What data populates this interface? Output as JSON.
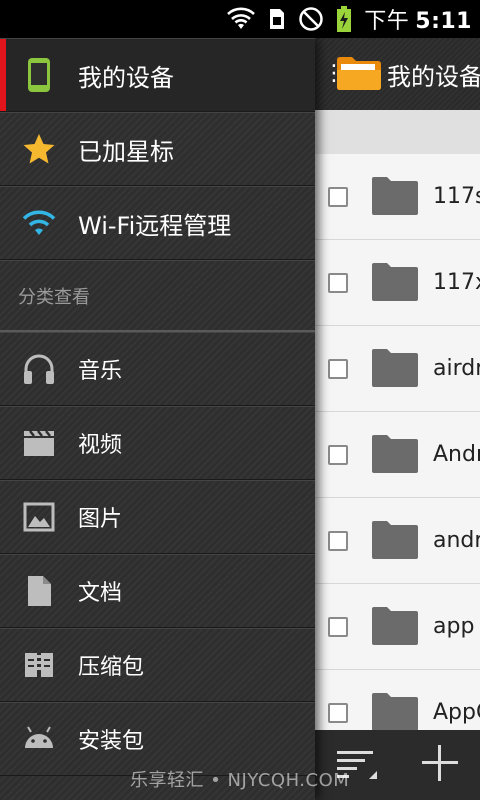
{
  "status_bar": {
    "ampm": "下午",
    "time": "5:11",
    "icons": [
      "wifi-icon",
      "sim-icon",
      "no-disturb-icon",
      "battery-charging-icon"
    ]
  },
  "drawer": {
    "top_items": [
      {
        "label": "我的设备",
        "icon": "device-icon",
        "active": true
      },
      {
        "label": "已加星标",
        "icon": "star-icon",
        "active": false
      },
      {
        "label": "Wi-Fi远程管理",
        "icon": "wifi-remote-icon",
        "active": false
      }
    ],
    "section_label": "分类查看",
    "categories": [
      {
        "label": "音乐",
        "icon": "headphones-icon"
      },
      {
        "label": "视频",
        "icon": "video-icon"
      },
      {
        "label": "图片",
        "icon": "image-icon"
      },
      {
        "label": "文档",
        "icon": "document-icon"
      },
      {
        "label": "压缩包",
        "icon": "archive-icon"
      },
      {
        "label": "安装包",
        "icon": "android-icon"
      }
    ]
  },
  "file_panel": {
    "title": "我的设备",
    "files": [
      {
        "name": "117s"
      },
      {
        "name": "117x"
      },
      {
        "name": "airdr"
      },
      {
        "name": "Andr"
      },
      {
        "name": "andr"
      },
      {
        "name": "app"
      },
      {
        "name": "AppC"
      }
    ]
  },
  "watermark": "乐享轻汇 • NJYCQH.COM",
  "colors": {
    "accent_red": "#e0141a",
    "star_yellow": "#f5b82e",
    "wifi_blue": "#33b5e5",
    "device_green": "#8cc63f"
  }
}
